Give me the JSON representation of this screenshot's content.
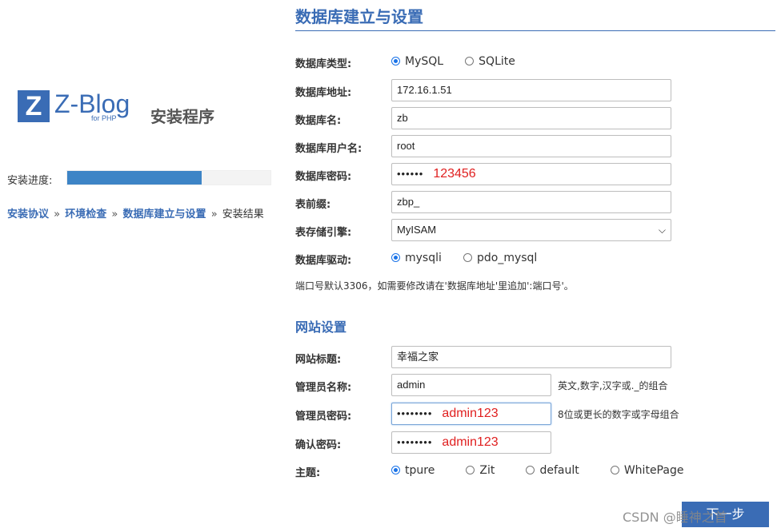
{
  "logo": {
    "mark": "Z",
    "brand": "Z-Blog",
    "subtitle": "for PHP",
    "title": "安装程序"
  },
  "progress": {
    "label": "安装进度:",
    "value_percent": 66
  },
  "steps": {
    "items": [
      "安装协议",
      "环境检查",
      "数据库建立与设置",
      "安装结果"
    ],
    "separator": "»"
  },
  "db": {
    "title": "数据库建立与设置",
    "type_label": "数据库类型:",
    "type_options": [
      "MySQL",
      "SQLite"
    ],
    "type_selected": "MySQL",
    "host_label": "数据库地址:",
    "host_value": "172.16.1.51",
    "name_label": "数据库名:",
    "name_value": "zb",
    "user_label": "数据库用户名:",
    "user_value": "root",
    "password_label": "数据库密码:",
    "password_mask": "••••••",
    "password_annotation": "123456",
    "prefix_label": "表前缀:",
    "prefix_value": "zbp_",
    "engine_label": "表存储引擎:",
    "engine_value": "MyISAM",
    "driver_label": "数据库驱动:",
    "driver_options": [
      "mysqli",
      "pdo_mysql"
    ],
    "driver_selected": "mysqli",
    "port_note": "端口号默认3306，如需要修改请在'数据库地址'里追加':端口号'。"
  },
  "site": {
    "title": "网站设置",
    "site_title_label": "网站标题:",
    "site_title_value": "幸福之家",
    "admin_name_label": "管理员名称:",
    "admin_name_value": "admin",
    "admin_name_hint": "英文,数字,汉字或._的组合",
    "admin_password_label": "管理员密码:",
    "admin_password_mask": "••••••••",
    "admin_password_annotation": "admin123",
    "admin_password_hint": "8位或更长的数字或字母组合",
    "confirm_label": "确认密码:",
    "confirm_mask": "••••••••",
    "confirm_annotation": "admin123",
    "theme_label": "主题:",
    "theme_options": [
      "tpure",
      "Zit",
      "default",
      "WhitePage"
    ],
    "theme_selected": "tpure"
  },
  "next_button": "下一步",
  "watermark": "CSDN @睡神之首",
  "colors": {
    "accent": "#3a6cb5",
    "progress": "#3d84c6",
    "annotation": "#e02020",
    "radio_on": "#1a73e8"
  }
}
